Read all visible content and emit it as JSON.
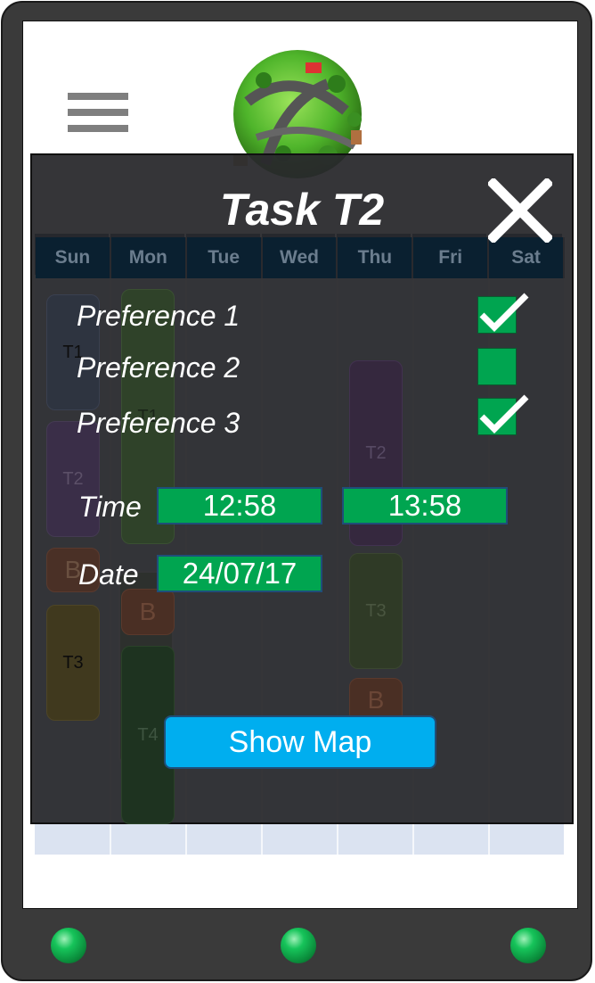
{
  "calendar": {
    "days": [
      "Sun",
      "Mon",
      "Tue",
      "Wed",
      "Thu",
      "Fri",
      "Sat"
    ],
    "tasks": {
      "sun_t1": "T1",
      "sun_t2": "T2",
      "sun_b": "B",
      "sun_t3": "T3",
      "mon_t1": "T1",
      "mon_b": "B",
      "mon_t4": "T4",
      "thu_t2": "T2",
      "thu_t3": "T3",
      "thu_b": "B"
    }
  },
  "modal": {
    "title": "Task T2",
    "preferences": [
      {
        "label": "Preference 1",
        "checked": true
      },
      {
        "label": "Preference 2",
        "checked": false
      },
      {
        "label": "Preference 3",
        "checked": true
      }
    ],
    "time_label": "Time",
    "time_start": "12:58",
    "time_end": "13:58",
    "date_label": "Date",
    "date_value": "24/07/17",
    "show_map_label": "Show Map"
  },
  "colors": {
    "field_green": "#00a550",
    "button_blue": "#00aeef",
    "header_navy": "#0a2d4a"
  },
  "icons": {
    "menu": "hamburger-menu-icon",
    "close": "close-icon",
    "check": "checkmark-icon",
    "logo": "globe-logo"
  }
}
